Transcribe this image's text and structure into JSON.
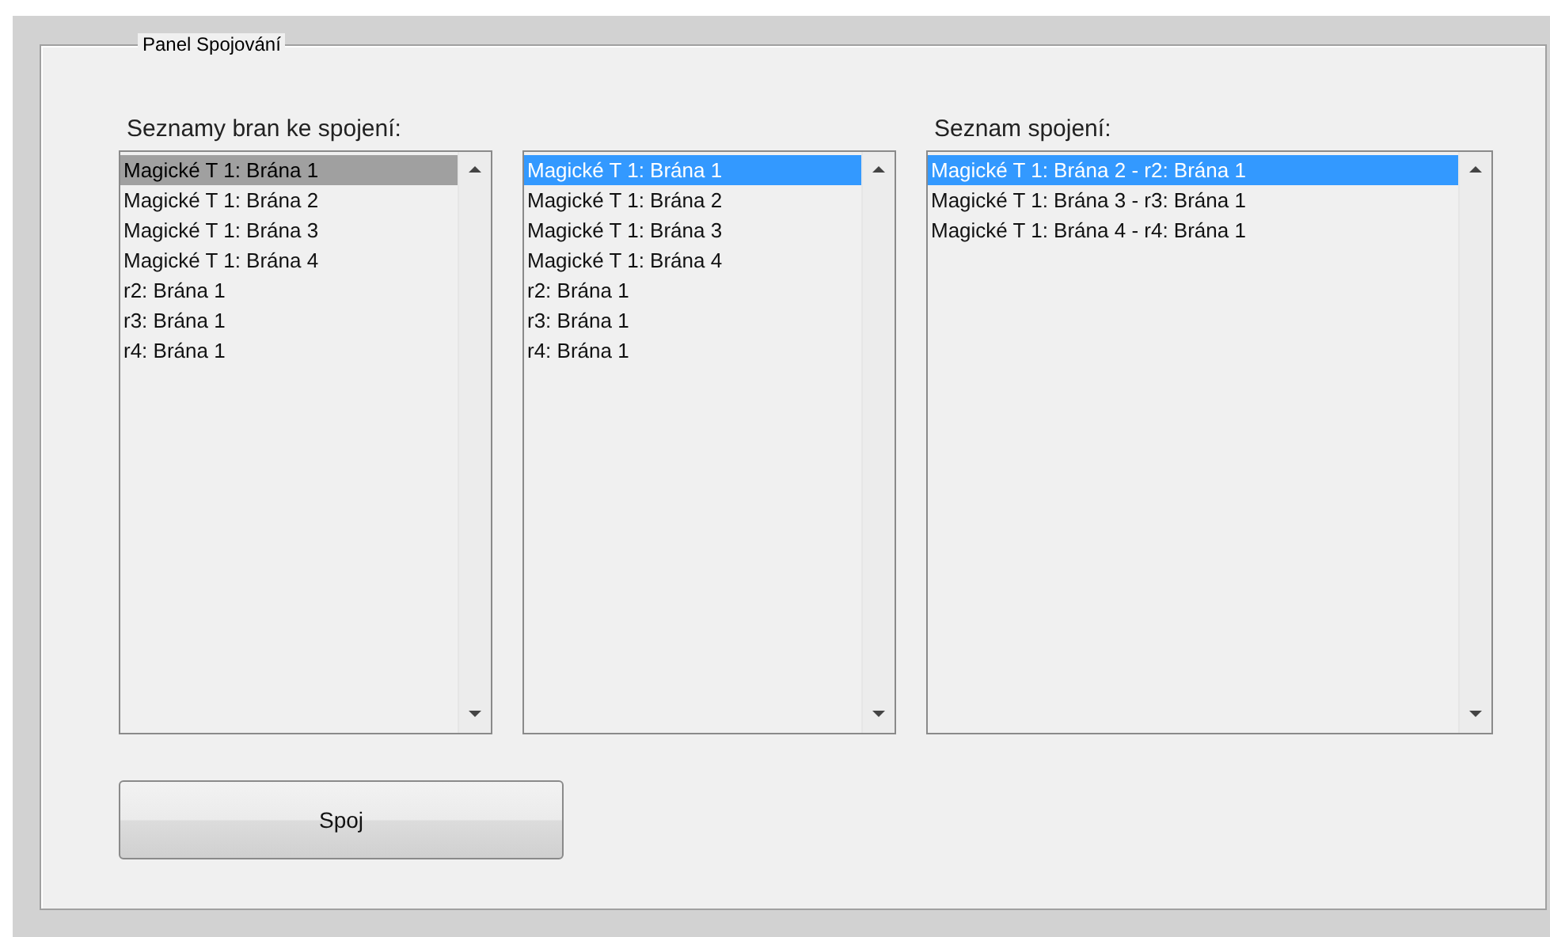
{
  "panel": {
    "title": "Panel Spojování"
  },
  "source_label": "Seznamy bran ke spojení:",
  "target_label": "Seznam spojení:",
  "lists": [
    {
      "focused": false,
      "items": [
        {
          "text": "Magické T 1: Brána 1",
          "selected": true
        },
        {
          "text": "Magické T 1: Brána 2",
          "selected": false
        },
        {
          "text": "Magické T 1: Brána 3",
          "selected": false
        },
        {
          "text": "Magické T 1: Brána 4",
          "selected": false
        },
        {
          "text": "r2: Brána 1",
          "selected": false
        },
        {
          "text": "r3: Brána 1",
          "selected": false
        },
        {
          "text": "r4: Brána 1",
          "selected": false
        }
      ]
    },
    {
      "focused": true,
      "items": [
        {
          "text": "Magické T 1: Brána 1",
          "selected": true
        },
        {
          "text": "Magické T 1: Brána 2",
          "selected": false
        },
        {
          "text": "Magické T 1: Brána 3",
          "selected": false
        },
        {
          "text": "Magické T 1: Brána 4",
          "selected": false
        },
        {
          "text": "r2: Brána 1",
          "selected": false
        },
        {
          "text": "r3: Brána 1",
          "selected": false
        },
        {
          "text": "r4: Brána 1",
          "selected": false
        }
      ]
    },
    {
      "focused": true,
      "items": [
        {
          "text": "Magické T 1: Brána 2 - r2: Brána 1",
          "selected": true
        },
        {
          "text": "Magické T 1: Brána 3 - r3: Brána 1",
          "selected": false
        },
        {
          "text": "Magické T 1: Brána 4 - r4: Brána 1",
          "selected": false
        }
      ]
    }
  ],
  "button": {
    "label": "Spoj"
  }
}
